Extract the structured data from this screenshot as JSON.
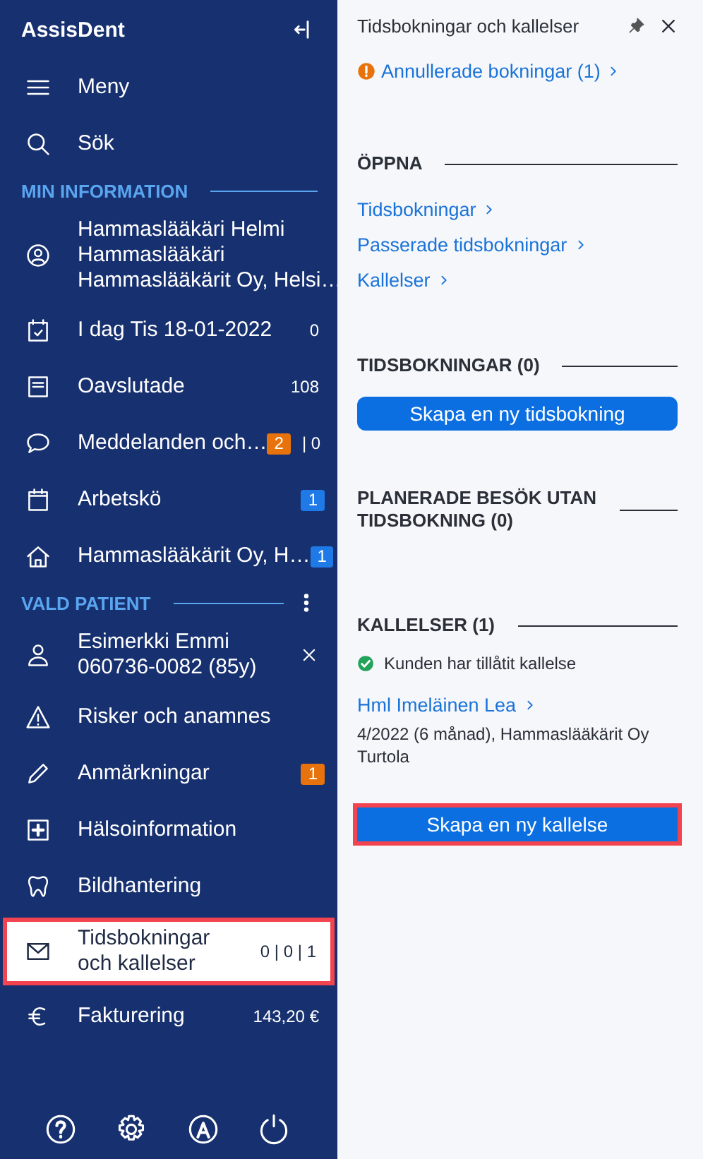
{
  "sidebar": {
    "brand": "AssisDent",
    "top_items": [
      {
        "lines": [
          "Meny"
        ]
      },
      {
        "lines": [
          "Sök"
        ]
      }
    ],
    "sections": [
      {
        "title": "MIN INFORMATION",
        "items": [
          {
            "lines": [
              "Hammaslääkäri Helmi",
              "Hammaslääkäri",
              "Hammaslääkärit Oy, Helsi…"
            ],
            "selected": false,
            "highlighted": false
          },
          {
            "lines": [
              "I dag Tis 18-01-2022"
            ],
            "selected": false,
            "highlighted": false,
            "trailing": [
              {
                "kind": "text",
                "text": "0"
              }
            ]
          },
          {
            "lines": [
              "Oavslutade"
            ],
            "selected": false,
            "highlighted": false,
            "trailing": [
              {
                "kind": "text",
                "text": "108"
              }
            ]
          },
          {
            "lines": [
              "Meddelanden och…"
            ],
            "selected": false,
            "highlighted": false,
            "trailing": [
              {
                "kind": "badge",
                "text": "2",
                "color": "#e8730c"
              },
              {
                "kind": "text",
                "text": "| 0"
              }
            ]
          },
          {
            "lines": [
              "Arbetskö"
            ],
            "selected": false,
            "highlighted": false,
            "trailing": [
              {
                "kind": "badge",
                "text": "1",
                "color": "#1f7ae8"
              }
            ]
          },
          {
            "lines": [
              "Hammaslääkärit Oy, H…"
            ],
            "selected": false,
            "highlighted": false,
            "trailing": [
              {
                "kind": "badge",
                "text": "1",
                "color": "#1f7ae8"
              }
            ]
          }
        ]
      },
      {
        "title": "VALD PATIENT",
        "items": [
          {
            "lines": [
              "Esimerkki Emmi",
              "060736-0082 (85y)"
            ],
            "selected": false,
            "highlighted": false
          },
          {
            "lines": [
              "Risker och anamnes"
            ],
            "selected": false,
            "highlighted": false
          },
          {
            "lines": [
              "Anmärkningar"
            ],
            "selected": false,
            "highlighted": false,
            "trailing": [
              {
                "kind": "badge",
                "text": "1",
                "color": "#e8730c"
              }
            ]
          },
          {
            "lines": [
              "Hälsoinformation"
            ],
            "selected": false,
            "highlighted": false
          },
          {
            "lines": [
              "Bildhantering"
            ],
            "selected": false,
            "highlighted": false
          },
          {
            "lines": [
              "Tidsbokningar",
              "och kallelser"
            ],
            "selected": true,
            "highlighted": true,
            "trailing": [
              {
                "kind": "text",
                "text": "0 | 0 | 1"
              }
            ]
          },
          {
            "lines": [
              "Fakturering"
            ],
            "selected": false,
            "highlighted": false,
            "trailing": [
              {
                "kind": "text",
                "text": "143,20 €"
              }
            ]
          }
        ]
      }
    ]
  },
  "panel": {
    "title": "Tidsbokningar och kallelser",
    "blocks": [
      {
        "kind": "alert_link",
        "text": "Annullerade bokningar (1)"
      },
      {
        "kind": "heading",
        "text": "ÖPPNA"
      },
      {
        "kind": "link",
        "text": "Tidsbokningar"
      },
      {
        "kind": "link",
        "text": "Passerade tidsbokningar"
      },
      {
        "kind": "link",
        "text": "Kallelser"
      },
      {
        "kind": "heading",
        "text": "TIDSBOKNINGAR (0)"
      },
      {
        "kind": "button",
        "text": "Skapa en ny tidsbokning",
        "highlighted": false
      },
      {
        "kind": "heading",
        "text": "PLANERADE BESÖK UTAN TIDSBOKNING (0)"
      },
      {
        "kind": "heading",
        "text": "KALLELSER (1)"
      },
      {
        "kind": "status",
        "text": "Kunden har tillåtit kallelse"
      },
      {
        "kind": "person_link",
        "text": "Hml Imeläinen Lea"
      },
      {
        "kind": "note",
        "text": "4/2022 (6 månad), Hammaslääkärit Oy Turtola"
      },
      {
        "kind": "button",
        "text": "Skapa en ny kallelse",
        "highlighted": true
      }
    ]
  }
}
